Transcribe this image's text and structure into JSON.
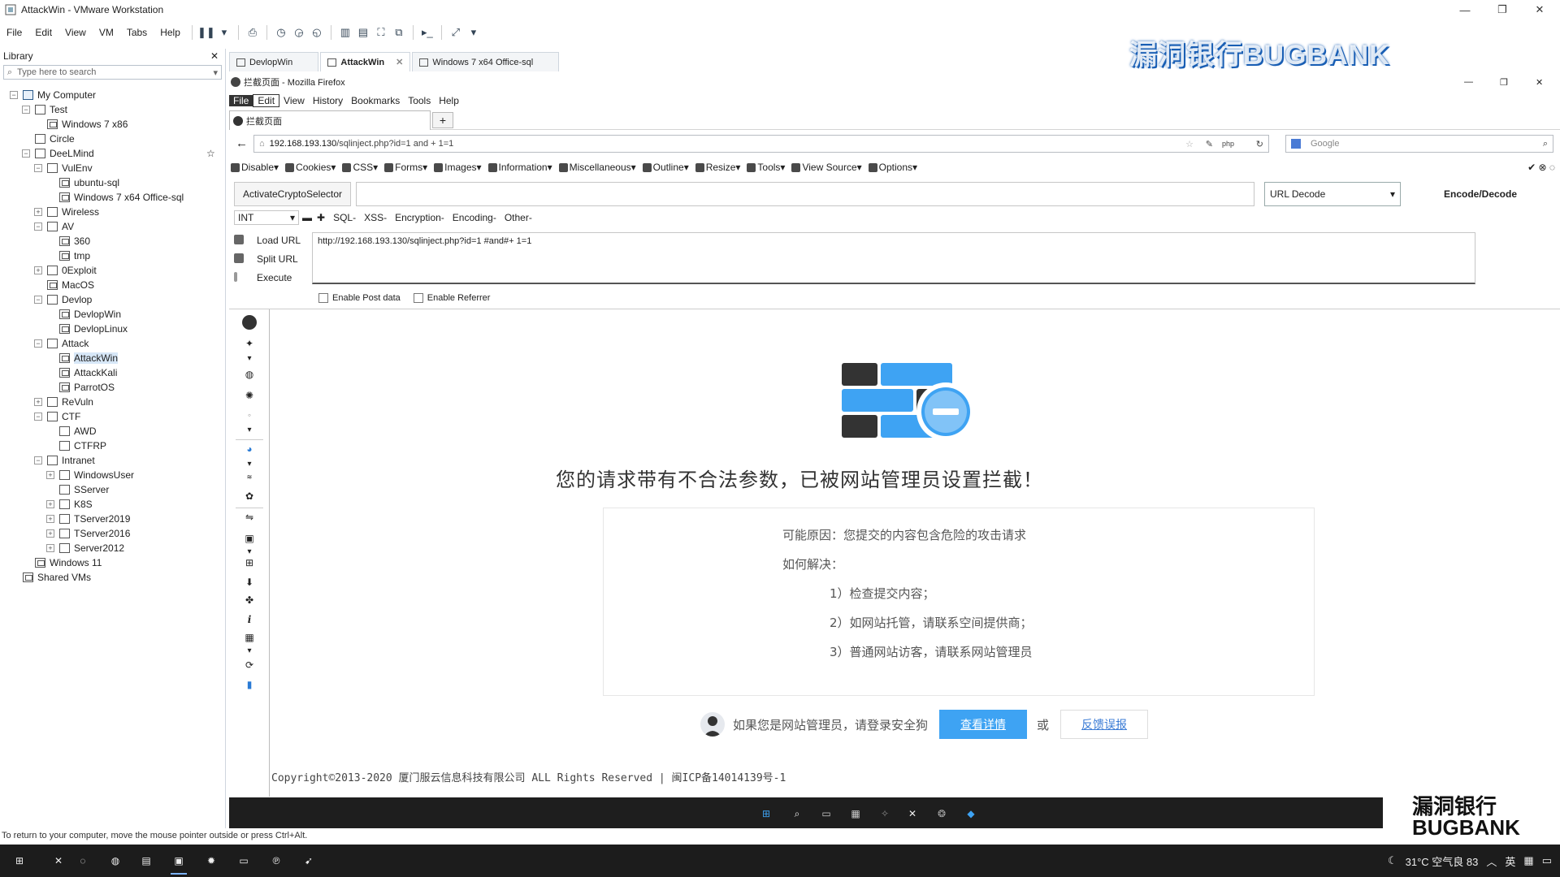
{
  "window": {
    "title": "AttackWin - VMware Workstation"
  },
  "vm_menu": [
    "File",
    "Edit",
    "View",
    "VM",
    "Tabs",
    "Help"
  ],
  "library": {
    "title": "Library",
    "search_placeholder": "Type here to search",
    "tree": [
      {
        "label": "My Computer",
        "level": 0,
        "expander": "-",
        "icon": "pc"
      },
      {
        "label": "Test",
        "level": 1,
        "expander": "-",
        "icon": "folder"
      },
      {
        "label": "Windows 7 x86",
        "level": 2,
        "expander": "",
        "icon": "vm"
      },
      {
        "label": "Circle",
        "level": 1,
        "expander": "",
        "icon": "folder"
      },
      {
        "label": "DeeLMind",
        "level": 1,
        "expander": "-",
        "icon": "folder"
      },
      {
        "label": "VulEnv",
        "level": 2,
        "expander": "-",
        "icon": "folder"
      },
      {
        "label": "ubuntu-sql",
        "level": 3,
        "expander": "",
        "icon": "vm"
      },
      {
        "label": "Windows 7 x64 Office-sql",
        "level": 3,
        "expander": "",
        "icon": "vm"
      },
      {
        "label": "Wireless",
        "level": 2,
        "expander": "+",
        "icon": "folder"
      },
      {
        "label": "AV",
        "level": 2,
        "expander": "-",
        "icon": "folder"
      },
      {
        "label": "360",
        "level": 3,
        "expander": "",
        "icon": "vm"
      },
      {
        "label": "tmp",
        "level": 3,
        "expander": "",
        "icon": "vm"
      },
      {
        "label": "0Exploit",
        "level": 2,
        "expander": "+",
        "icon": "folder"
      },
      {
        "label": "MacOS",
        "level": 2,
        "expander": "",
        "icon": "vm"
      },
      {
        "label": "Devlop",
        "level": 2,
        "expander": "-",
        "icon": "folder"
      },
      {
        "label": "DevlopWin",
        "level": 3,
        "expander": "",
        "icon": "vm"
      },
      {
        "label": "DevlopLinux",
        "level": 3,
        "expander": "",
        "icon": "vm"
      },
      {
        "label": "Attack",
        "level": 2,
        "expander": "-",
        "icon": "folder"
      },
      {
        "label": "AttackWin",
        "level": 3,
        "expander": "",
        "icon": "vm",
        "selected": true
      },
      {
        "label": "AttackKali",
        "level": 3,
        "expander": "",
        "icon": "vm"
      },
      {
        "label": "ParrotOS",
        "level": 3,
        "expander": "",
        "icon": "vm"
      },
      {
        "label": "ReVuln",
        "level": 2,
        "expander": "+",
        "icon": "folder"
      },
      {
        "label": "CTF",
        "level": 2,
        "expander": "-",
        "icon": "folder"
      },
      {
        "label": "AWD",
        "level": 3,
        "expander": "",
        "icon": "folder"
      },
      {
        "label": "CTFRP",
        "level": 3,
        "expander": "",
        "icon": "folder"
      },
      {
        "label": "Intranet",
        "level": 2,
        "expander": "-",
        "icon": "folder"
      },
      {
        "label": "WindowsUser",
        "level": 3,
        "expander": "+",
        "icon": "folder"
      },
      {
        "label": "SServer",
        "level": 3,
        "expander": "",
        "icon": "folder"
      },
      {
        "label": "K8S",
        "level": 3,
        "expander": "+",
        "icon": "folder"
      },
      {
        "label": "TServer2019",
        "level": 3,
        "expander": "+",
        "icon": "folder"
      },
      {
        "label": "TServer2016",
        "level": 3,
        "expander": "+",
        "icon": "folder"
      },
      {
        "label": "Server2012",
        "level": 3,
        "expander": "+",
        "icon": "folder"
      },
      {
        "label": "Windows 11",
        "level": 1,
        "expander": "",
        "icon": "vm"
      },
      {
        "label": "Shared VMs",
        "level": 0,
        "expander": "",
        "icon": "vm"
      }
    ]
  },
  "status_bar": "To return to your computer, move the mouse pointer outside or press Ctrl+Alt.",
  "vm_tabs": [
    {
      "label": "DevlopWin",
      "active": false
    },
    {
      "label": "AttackWin",
      "active": true
    },
    {
      "label": "Windows 7 x64 Office-sql",
      "active": false
    }
  ],
  "firefox": {
    "title": "拦截页面 - Mozilla Firefox",
    "menu": [
      "File",
      "Edit",
      "View",
      "History",
      "Bookmarks",
      "Tools",
      "Help"
    ],
    "tab_title": "拦截页面",
    "new_tab": "+",
    "url_host": "192.168.193.130",
    "url_path": "/sqlinject.php?id=1 and + 1=1",
    "search_placeholder": "Google"
  },
  "dev_toolbar": [
    "Disable▾",
    "Cookies▾",
    "CSS▾",
    "Forms▾",
    "Images▾",
    "Information▾",
    "Miscellaneous▾",
    "Outline▾",
    "Resize▾",
    "Tools▾",
    "View Source▾",
    "Options▾"
  ],
  "hackbar": {
    "crypto_button": "ActivateCryptoSelector",
    "decode_select": "URL Decode",
    "encode_button": "Encode/Decode",
    "int_select": "INT",
    "menus": [
      "SQL-",
      "XSS-",
      "Encryption-",
      "Encoding-",
      "Other-"
    ],
    "actions": [
      "Load URL",
      "Split URL",
      "Execute"
    ],
    "url_value": "http://192.168.193.130/sqlinject.php?id=1 #and#+ 1=1",
    "post_label": "Enable Post data",
    "referrer_label": "Enable Referrer"
  },
  "block_page": {
    "title": "您的请求带有不合法参数，已被网站管理员设置拦截！",
    "reason": "可能原因：您提交的内容包含危险的攻击请求",
    "solution_title": "如何解决：",
    "steps": [
      "1）检查提交内容；",
      "2）如网站托管，请联系空间提供商；",
      "3）普通网站访客，请联系网站管理员"
    ],
    "admin_text": "如果您是网站管理员，请登录安全狗",
    "detail_button": "查看详情",
    "or_text": "或",
    "report_button": "反馈误报",
    "copyright": "Copyright©2013-2020 厦门服云信息科技有限公司 ALL Rights Reserved | 闽ICP备14014139号-1",
    "colors": {
      "accent": "#3ea3f3",
      "dark_block": "#333333"
    }
  },
  "tray": {
    "weather": "31°C 空气良 83",
    "ime": "英"
  },
  "watermark": {
    "top": "漏洞银行BUGBANK",
    "bottom_line1": "漏洞银行",
    "bottom_line2": "BUGBANK"
  }
}
